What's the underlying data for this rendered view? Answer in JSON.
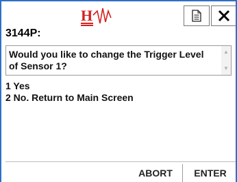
{
  "window": {
    "title": "3144P:",
    "logo_text": "H"
  },
  "header_buttons": {
    "doc_icon": "document-icon",
    "close_icon": "close-icon"
  },
  "prompt": {
    "text": "Would you like to change the Trigger Level of Sensor 1?"
  },
  "options": [
    {
      "label": "1 Yes"
    },
    {
      "label": "2 No. Return to Main Screen"
    }
  ],
  "footer": {
    "abort_label": "ABORT",
    "enter_label": "ENTER"
  },
  "colors": {
    "frame_border": "#2f6fc9",
    "logo_red": "#d42020"
  }
}
